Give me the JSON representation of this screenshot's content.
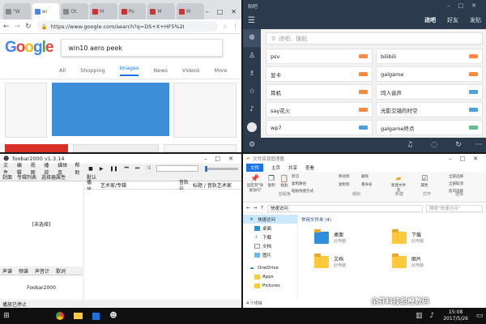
{
  "chrome": {
    "tabs": [
      "\"W",
      "wi",
      "Ot",
      "M",
      "Po",
      "M",
      "M"
    ],
    "url": "https://www.google.com/search?q=DS+X+HF5%2I",
    "logo_letters": [
      "G",
      "o",
      "o",
      "g",
      "l",
      "e"
    ],
    "logo_colors": [
      "#4285f4",
      "#ea4335",
      "#fbbc05",
      "#4285f4",
      "#34a853",
      "#ea4335"
    ],
    "query": "win10 aero peek",
    "nav": [
      "All",
      "Shopping",
      "Images",
      "News",
      "Videos",
      "More"
    ],
    "active_nav": "Images",
    "thumb_color": "#3d8fd6"
  },
  "foobar": {
    "title": "foobar2000 v1.3.14",
    "menu": [
      "文件",
      "编辑",
      "视图",
      "播放",
      "媒体库",
      "帮助"
    ],
    "left_tabs": [
      "封面",
      "专辑列表",
      "选择器属性"
    ],
    "right_tab": "默认",
    "columns": [
      "播放...",
      "艺术家/专辑",
      "音轨号",
      "标题 / 音轨艺术家"
    ],
    "none_selected": "[未选择]",
    "bottom_tabs": [
      "声谱",
      "频谱",
      "声音计",
      "歌词"
    ],
    "logo_text": "Foobar2000",
    "status": "播放已停止"
  },
  "tieba": {
    "title": "贴吧",
    "header_tabs": [
      "进吧",
      "好友",
      "发贴"
    ],
    "search_placeholder": "进吧、搜贴",
    "cards": [
      {
        "name": "psv",
        "color": "#ff8a3d"
      },
      {
        "name": "bilibili",
        "color": "#ff8a3d"
      },
      {
        "name": "显卡",
        "color": "#ff8a3d"
      },
      {
        "name": "galgame",
        "color": "#ff8a3d"
      },
      {
        "name": "耳机",
        "color": "#ff8a3d"
      },
      {
        "name": "同人音声",
        "color": "#4aa3df"
      },
      {
        "name": "say花火",
        "color": "#ff8a3d"
      },
      {
        "name": "光影交错的时空",
        "color": "#4aa3df"
      },
      {
        "name": "wp7",
        "color": "#4aa3df"
      },
      {
        "name": "galgame终点",
        "color": "#5cc28b"
      }
    ]
  },
  "explorer": {
    "title": "文件资源管理器",
    "ribbon_tabs": [
      "文件",
      "主页",
      "共享",
      "查看"
    ],
    "ribbon_groups": [
      "剪贴板",
      "组织",
      "新建",
      "打开",
      "选择"
    ],
    "ribbon_items": [
      "固定到\"快速访问\"",
      "复制",
      "粘贴",
      "剪切",
      "复制路径",
      "粘贴快捷方式",
      "移动到",
      "复制到",
      "删除",
      "重命名",
      "新建文件夹",
      "属性",
      "全部选择",
      "全部取消",
      "反向选择"
    ],
    "address": "快速访问",
    "search_placeholder": "搜索\"快速访问\"",
    "nav": [
      "快速访问",
      "桌面",
      "下载",
      "文档",
      "图片",
      "OneDrive",
      "Apps",
      "Pictures"
    ],
    "section": "常用文件夹 (4)",
    "folders": [
      {
        "name": "桌面",
        "sub": "此电脑"
      },
      {
        "name": "下载",
        "sub": "此电脑"
      },
      {
        "name": "文档",
        "sub": "此电脑"
      },
      {
        "name": "图片",
        "sub": "此电脑"
      }
    ],
    "status": "4 个项目"
  },
  "taskbar": {
    "time": "15:08",
    "date": "2017/5/26",
    "watermark": "全芬科技甜橙数码"
  }
}
